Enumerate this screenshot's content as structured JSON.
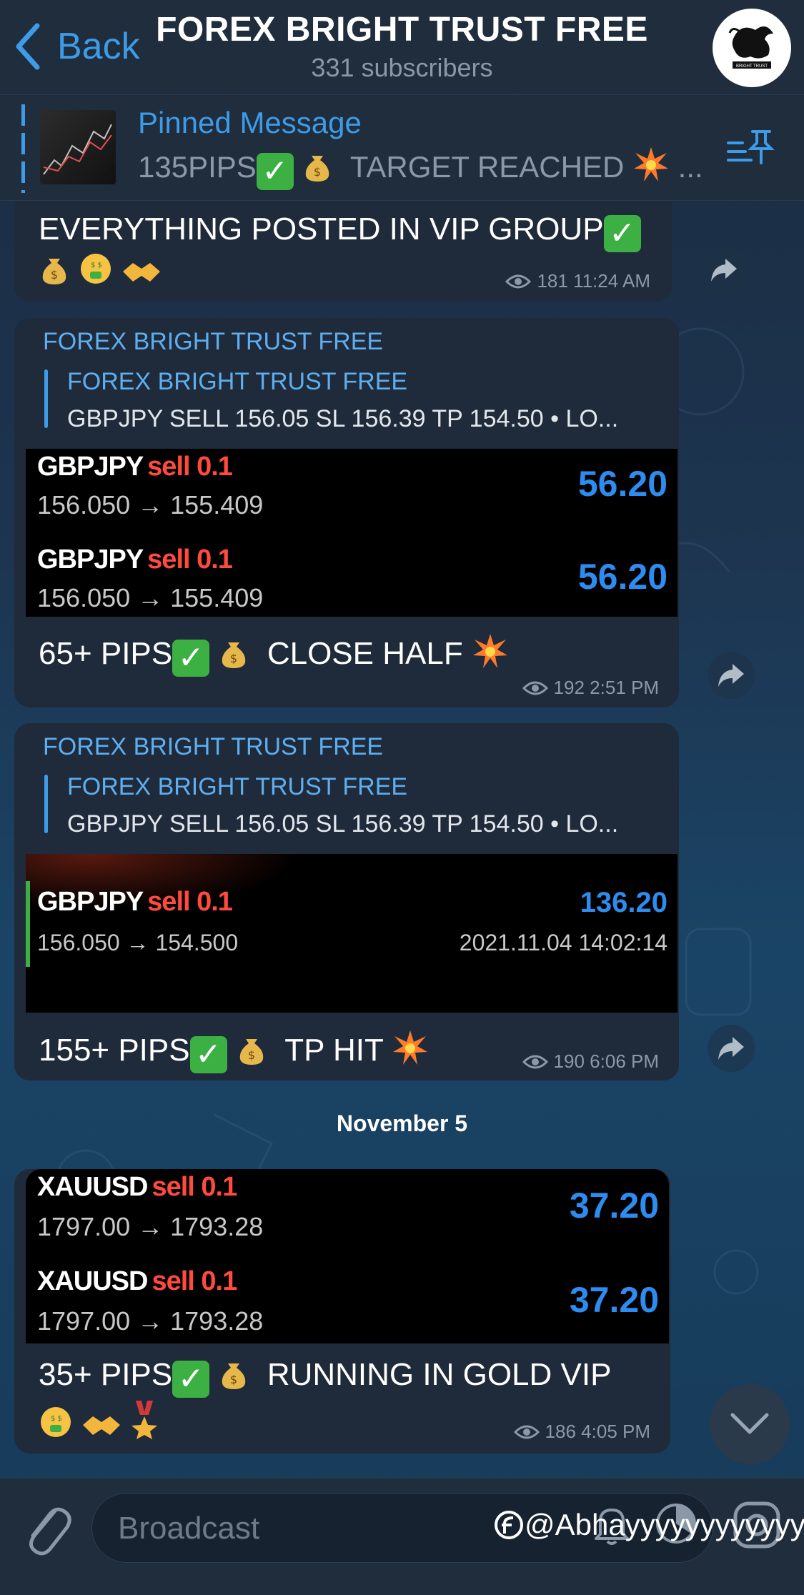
{
  "header": {
    "back_label": "Back",
    "title": "FOREX BRIGHT TRUST FREE",
    "subtitle": "331 subscribers",
    "avatar_text": "BRIGHT TRUST"
  },
  "pinned": {
    "label": "Pinned Message",
    "text_a": "135PIPS",
    "text_b": "TARGET REACHED",
    "text_c": "..."
  },
  "messages": [
    {
      "line1": "EVERYTHING POSTED IN VIP GROUP",
      "views": "181",
      "time": "11:24 AM"
    },
    {
      "sender": "FOREX BRIGHT TRUST FREE",
      "quote_name": "FOREX BRIGHT TRUST FREE",
      "quote_text": "GBPJPY SELL 156.05 SL 156.39 TP 154.50 • LO...",
      "trades": [
        {
          "symbol": "GBPJPY",
          "side": "sell 0.1",
          "prices": "156.050 → 155.409",
          "profit": "56.20"
        },
        {
          "symbol": "GBPJPY",
          "side": "sell 0.1",
          "prices": "156.050 → 155.409",
          "profit": "56.20"
        }
      ],
      "text_a": "65+ PIPS",
      "text_b": "CLOSE HALF",
      "views": "192",
      "time": "2:51 PM"
    },
    {
      "sender": "FOREX BRIGHT TRUST FREE",
      "quote_name": "FOREX BRIGHT TRUST FREE",
      "quote_text": "GBPJPY SELL 156.05 SL 156.39 TP 154.50 • LO...",
      "trades": [
        {
          "symbol": "GBPJPY",
          "side": "sell 0.1",
          "prices": "156.050 → 154.500",
          "profit": "136.20",
          "timestamp": "2021.11.04 14:02:14"
        }
      ],
      "text_a": "155+ PIPS",
      "text_b": "TP HIT",
      "views": "190",
      "time": "6:06 PM"
    },
    {
      "trades": [
        {
          "symbol": "XAUUSD",
          "side": "sell 0.1",
          "prices": "1797.00 → 1793.28",
          "profit": "37.20"
        },
        {
          "symbol": "XAUUSD",
          "side": "sell 0.1",
          "prices": "1797.00 → 1793.28",
          "profit": "37.20"
        }
      ],
      "text_a": "35+ PIPS",
      "text_b": "RUNNING IN GOLD VIP",
      "views": "186",
      "time": "4:05 PM"
    }
  ],
  "date_separator": "November 5",
  "composer": {
    "placeholder": "Broadcast"
  },
  "watermark": "@Abhayyyyyyyyyyyy",
  "colors": {
    "accent": "#3e9be8",
    "sell": "#ff4a3d",
    "profit": "#2e8cf0",
    "bubble": "#1f2b3a"
  }
}
